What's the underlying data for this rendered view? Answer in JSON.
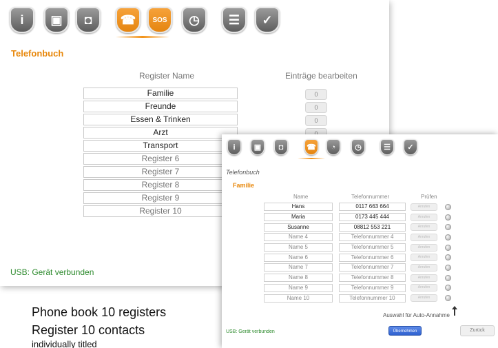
{
  "back_window": {
    "tabs": [
      {
        "icon": "info-icon",
        "glyph": "i",
        "active": false
      },
      {
        "icon": "device-icon",
        "glyph": "▣",
        "active": false
      },
      {
        "icon": "plug-icon",
        "glyph": "◘",
        "active": false
      },
      {
        "icon": "phonebook-icon",
        "glyph": "☎",
        "active": true
      },
      {
        "icon": "sos-icon",
        "glyph": "SOS",
        "active": true
      },
      {
        "icon": "clock-icon",
        "glyph": "◷",
        "active": false
      },
      {
        "icon": "settings-list-icon",
        "glyph": "☰",
        "active": false
      },
      {
        "icon": "check-icon",
        "glyph": "✓",
        "active": false
      }
    ],
    "title": "Telefonbuch",
    "col_register": "Register Name",
    "col_entries": "Einträge bearbeiten",
    "registers": [
      {
        "name": "Familie",
        "muted": false
      },
      {
        "name": "Freunde",
        "muted": false
      },
      {
        "name": "Essen & Trinken",
        "muted": false
      },
      {
        "name": "Arzt",
        "muted": false
      },
      {
        "name": "Transport",
        "muted": false
      },
      {
        "name": "Register 6",
        "muted": true
      },
      {
        "name": "Register 7",
        "muted": true
      },
      {
        "name": "Register 8",
        "muted": true
      },
      {
        "name": "Register 9",
        "muted": true
      },
      {
        "name": "Register 10",
        "muted": true
      }
    ],
    "entry_counts": [
      "0",
      "0",
      "0",
      "0"
    ],
    "usb_status": "USB: Gerät verbunden"
  },
  "front_window": {
    "tabs": [
      {
        "icon": "info-icon",
        "glyph": "i",
        "active": false
      },
      {
        "icon": "device-icon",
        "glyph": "▣",
        "active": false
      },
      {
        "icon": "plug-icon",
        "glyph": "◘",
        "active": false
      },
      {
        "icon": "phonebook-icon",
        "glyph": "☎",
        "active": true
      },
      {
        "icon": "alarm-icon",
        "glyph": "◔",
        "active": false
      },
      {
        "icon": "clock-icon",
        "glyph": "◷",
        "active": false
      },
      {
        "icon": "settings-list-icon",
        "glyph": "☰",
        "active": false
      },
      {
        "icon": "check-icon",
        "glyph": "✓",
        "active": false
      }
    ],
    "title": "Telefonbuch",
    "subtitle": "Familie",
    "col_name": "Name",
    "col_phone": "Telefonnummer",
    "col_check": "Prüfen",
    "check_label": "Anrufen",
    "contacts": [
      {
        "name": "Hans",
        "phone": "0117 663 664",
        "muted": false
      },
      {
        "name": "Maria",
        "phone": "0173 445 444",
        "muted": false
      },
      {
        "name": "Susanne",
        "phone": "08812 553 221",
        "muted": false
      },
      {
        "name": "Name 4",
        "phone": "Telefonnummer 4",
        "muted": true
      },
      {
        "name": "Name 5",
        "phone": "Telefonnummer 5",
        "muted": true
      },
      {
        "name": "Name 6",
        "phone": "Telefonnummer 6",
        "muted": true
      },
      {
        "name": "Name 7",
        "phone": "Telefonnummer 7",
        "muted": true
      },
      {
        "name": "Name 8",
        "phone": "Telefonnummer 8",
        "muted": true
      },
      {
        "name": "Name 9",
        "phone": "Telefonnummer 9",
        "muted": true
      },
      {
        "name": "Name 10",
        "phone": "Telefonnummer 10",
        "muted": true
      }
    ],
    "auto_answer_label": "Auswahl für Auto-Annahme",
    "usb_status": "USB: Gerät verbunden",
    "save_button": "Übernehmen",
    "back_button": "Zurück"
  },
  "caption": {
    "line1": "Phone book 10 registers",
    "line2": "Register 10 contacts",
    "line3": "individually titled"
  },
  "colors": {
    "accent_orange": "#e8880c",
    "status_green": "#2e8b2e",
    "primary_blue": "#2f61cf"
  }
}
